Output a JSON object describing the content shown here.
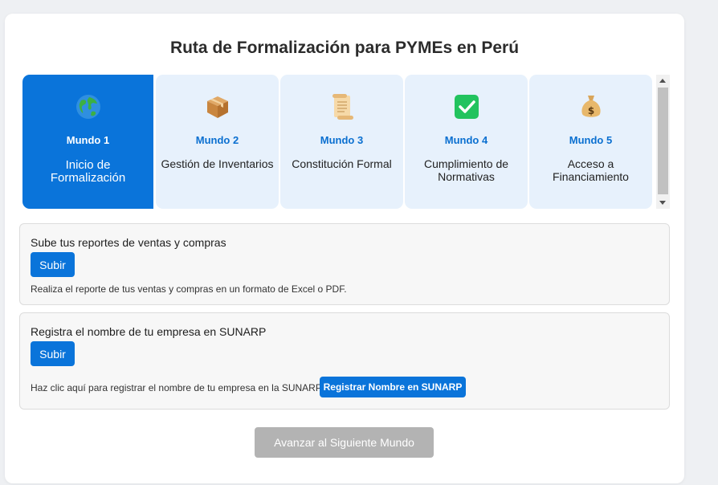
{
  "title": "Ruta de Formalización para PYMEs en Perú",
  "worlds": [
    {
      "name": "Mundo 1",
      "description": "Inicio de Formalización",
      "icon": "globe-icon",
      "active": true
    },
    {
      "name": "Mundo 2",
      "description": "Gestión de Inventarios",
      "icon": "package-icon",
      "active": false
    },
    {
      "name": "Mundo 3",
      "description": "Constitución Formal",
      "icon": "scroll-icon",
      "active": false
    },
    {
      "name": "Mundo 4",
      "description": "Cumplimiento de Normativas",
      "icon": "check-icon",
      "active": false
    },
    {
      "name": "Mundo 5",
      "description": "Acceso a Financiamiento",
      "icon": "money-bag-icon",
      "active": false
    }
  ],
  "tasks": {
    "reports": {
      "title": "Sube tus reportes de ventas y compras",
      "button": "Subir",
      "note": "Realiza el reporte de tus ventas y compras en un formato de Excel o PDF."
    },
    "sunarp": {
      "title": "Registra el nombre de tu empresa en SUNARP",
      "button": "Subir",
      "note": "Haz clic aquí para registrar el nombre de tu empresa en la SUNARP:",
      "link_button": "Registrar Nombre en SUNARP"
    }
  },
  "advance_button": "Avanzar al Siguiente Mundo",
  "colors": {
    "accent": "#0a74da",
    "world_bg": "#e7f1fc",
    "disabled": "#b3b3b3"
  }
}
